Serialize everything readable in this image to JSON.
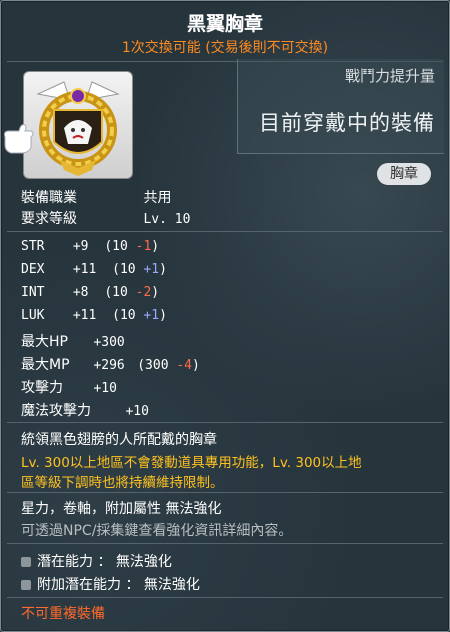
{
  "header": {
    "title": "黑翼胸章",
    "trade_note": "1次交換可能 (交易後則不可交換)"
  },
  "power": {
    "label": "戰鬥力提升量",
    "value": "目前穿戴中的裝備"
  },
  "category_badge": "胸章",
  "requirements": {
    "job_label": "裝備職業",
    "job_value": "共用",
    "level_label": "要求等級",
    "level_value": "Lv. 10"
  },
  "stats": [
    {
      "name": "STR",
      "base": "+9",
      "open": "(10 ",
      "mod": "-1",
      "close": ")",
      "mod_type": "neg"
    },
    {
      "name": "DEX",
      "base": "+11",
      "open": "(10 ",
      "mod": "+1",
      "close": ")",
      "mod_type": "pos"
    },
    {
      "name": "INT",
      "base": "+8",
      "open": "(10 ",
      "mod": "-2",
      "close": ")",
      "mod_type": "neg"
    },
    {
      "name": "LUK",
      "base": "+11",
      "open": "(10 ",
      "mod": "+1",
      "close": ")",
      "mod_type": "pos"
    }
  ],
  "stats2": {
    "hp_label": "最大HP",
    "hp_value": "+300",
    "mp_label": "最大MP",
    "mp_value": "+296",
    "mp_open": "(300 ",
    "mp_mod": "-4",
    "mp_close": ")",
    "atk_label": "攻擊力",
    "atk_value": "+10",
    "matk_label": "魔法攻擊力",
    "matk_value": "+10"
  },
  "description": {
    "line1": "統領黑色翅膀的人所配戴的胸章",
    "warn1": "Lv. 300以上地區不會發動道具專用功能，Lv. 300以上地",
    "warn2": "區等級下調時也將持續維持限制。"
  },
  "enhance": {
    "line1": "星力，卷軸，附加屬性 無法強化",
    "line2": "可透過NPC/採集鍵查看強化資訊詳細內容。"
  },
  "potential": {
    "pot_label": "潛在能力 ： 無法強化",
    "add_pot_label": "附加潛在能力 ： 無法強化"
  },
  "footer": {
    "no_duplicate": "不可重複裝備"
  },
  "colors": {
    "trade_orange": "#ff8a1e",
    "warn_yellow": "#ffc21e",
    "neg_red": "#ff6a4a",
    "pos_blue": "#9aa8ff"
  }
}
